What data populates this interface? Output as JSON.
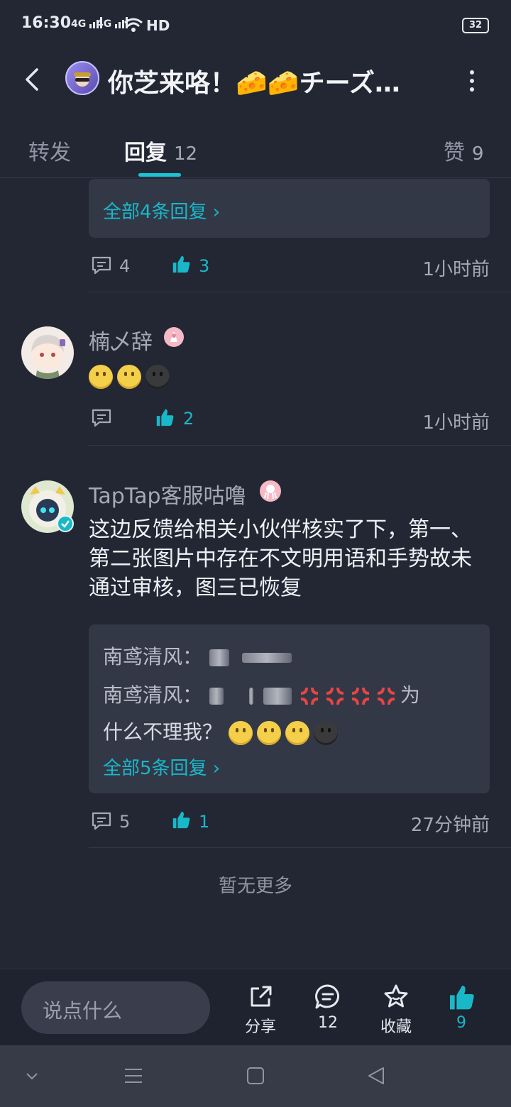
{
  "status_bar": {
    "time": "16:30",
    "signal1": "4G",
    "signal2": "4G",
    "network": "HD",
    "battery": "32"
  },
  "header": {
    "title": "你芝来咯！🧀🧀チーズ…",
    "back_icon": "chevron-left-icon",
    "more_icon": "more-vertical-icon"
  },
  "tabs": [
    {
      "label": "转发",
      "count": ""
    },
    {
      "label": "回复",
      "count": "12"
    },
    {
      "label": "赞",
      "count": "9"
    }
  ],
  "thread0": {
    "view_all": "全部4条回复 ›",
    "comments": "4",
    "likes": "3",
    "time": "1小时前"
  },
  "reply1": {
    "username": "楠乄辞",
    "body_emojis": [
      "slightly-smiling-face",
      "slightly-smiling-face",
      "dark-face"
    ],
    "likes": "2",
    "time": "1小时前"
  },
  "reply2": {
    "username": "TapTap客服咕噜",
    "body": "这边反馈给相关小伙伴核实了下，第一、第二张图片中存在不文明用语和手势故未通过审核，图三已恢复",
    "quote": {
      "line1_name": "南鸢清风：",
      "line2_name": "南鸢清风：",
      "line2_suffix": "为",
      "line3_text": "什么不理我？",
      "view_all": "全部5条回复 ›"
    },
    "comments": "5",
    "likes": "1",
    "time": "27分钟前"
  },
  "no_more": "暂无更多",
  "bottom_bar": {
    "input_placeholder": "说点什么",
    "share_label": "分享",
    "comment_count": "12",
    "favorite_label": "收藏",
    "like_count": "9"
  },
  "colors": {
    "accent": "#19b8c9",
    "background": "#232734",
    "card": "#333847"
  }
}
